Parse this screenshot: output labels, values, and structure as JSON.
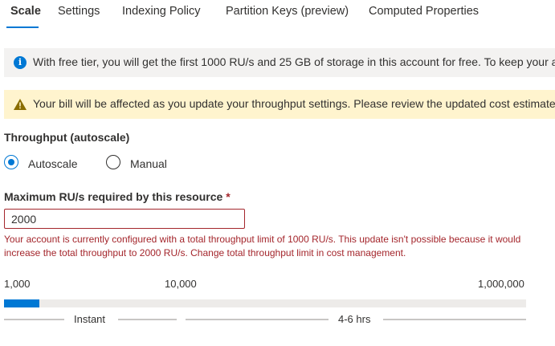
{
  "tabs": [
    {
      "label": "Scale",
      "active": true
    },
    {
      "label": "Settings"
    },
    {
      "label": "Indexing Policy"
    },
    {
      "label": "Partition Keys (preview)"
    },
    {
      "label": "Computed Properties"
    }
  ],
  "info_banner": {
    "icon": "info-icon",
    "text": "With free tier, you will get the first 1000 RU/s and 25 GB of storage in this account for free. To keep your account free, keep the total RU/s across all resources in the account to 1000 RU/s."
  },
  "warning_banner": {
    "icon": "warning-icon",
    "text": "Your bill will be affected as you update your throughput settings. Please review the updated cost estimate below before saving your changes"
  },
  "throughput": {
    "title": "Throughput (autoscale)",
    "options": [
      {
        "label": "Autoscale",
        "checked": true
      },
      {
        "label": "Manual",
        "checked": false
      }
    ]
  },
  "max_ru": {
    "label": "Maximum RU/s required by this resource",
    "required_marker": "*",
    "value": "2000",
    "error": "Your account is currently configured with a total throughput limit of 1000 RU/s. This update isn't possible because it would increase the total throughput to 2000 RU/s. Change total throughput limit in cost management."
  },
  "slider": {
    "ticks": [
      "1,000",
      "10,000",
      "1,000,000"
    ],
    "fill_fraction": 0.067
  },
  "timeline": {
    "labels": [
      "Instant",
      "4-6 hrs"
    ]
  },
  "colors": {
    "accent": "#0078d4",
    "error": "#a4262c",
    "warning_bg": "#fff4ce",
    "info_bg": "#f3f2f1"
  }
}
